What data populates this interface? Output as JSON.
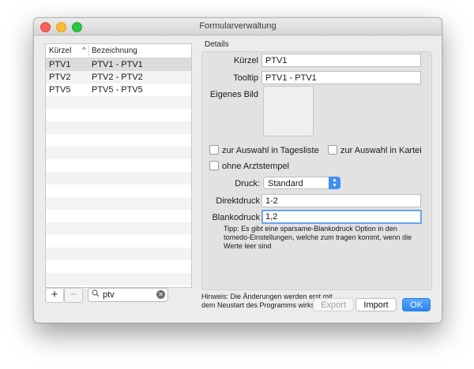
{
  "window": {
    "title": "Formularverwaltung"
  },
  "table": {
    "columns": [
      "Kürzel",
      "Bezeichnung"
    ],
    "sort_indicator": "^",
    "rows": [
      {
        "kuerzel": "PTV1",
        "bezeichnung": "PTV1 - PTV1"
      },
      {
        "kuerzel": "PTV2",
        "bezeichnung": "PTV2 - PTV2"
      },
      {
        "kuerzel": "PTV5",
        "bezeichnung": "PTV5 - PTV5"
      }
    ],
    "selected_index": 0
  },
  "controls": {
    "add": "+",
    "remove": "−"
  },
  "search": {
    "value": "ptv",
    "icon": "search-icon",
    "clear_icon": "clear-icon"
  },
  "details": {
    "label": "Details",
    "kuerzel_label": "Kürzel",
    "kuerzel_value": "PTV1",
    "tooltip_label": "Tooltip",
    "tooltip_value": "PTV1 - PTV1",
    "bild_label": "Eigenes Bild",
    "check_tagesliste": "zur Auswahl in Tagesliste",
    "check_kartei": "zur Auswahl in Kartei",
    "check_arztstempel": "ohne Arztstempel",
    "druck_label": "Druck:",
    "druck_value": "Standard",
    "direktdruck_label": "Direktdruck",
    "direktdruck_value": "1-2",
    "blankodruck_label": "Blankodruck",
    "blankodruck_value": "1,2",
    "tip": "Tipp: Es gibt eine sparsame-Blankodruck Option in den tomedo-Einstellungen, welche zum tragen kommt, wenn die  Werte leer sind"
  },
  "footer": {
    "hint": "Hinweis: Die Änderungen werden erst mit dem Neustart des Programms wirksam.",
    "export": "Export",
    "import": "Import",
    "ok": "OK"
  },
  "colors": {
    "accent": "#2d86f4",
    "selected_row": "#dcdcdc"
  }
}
